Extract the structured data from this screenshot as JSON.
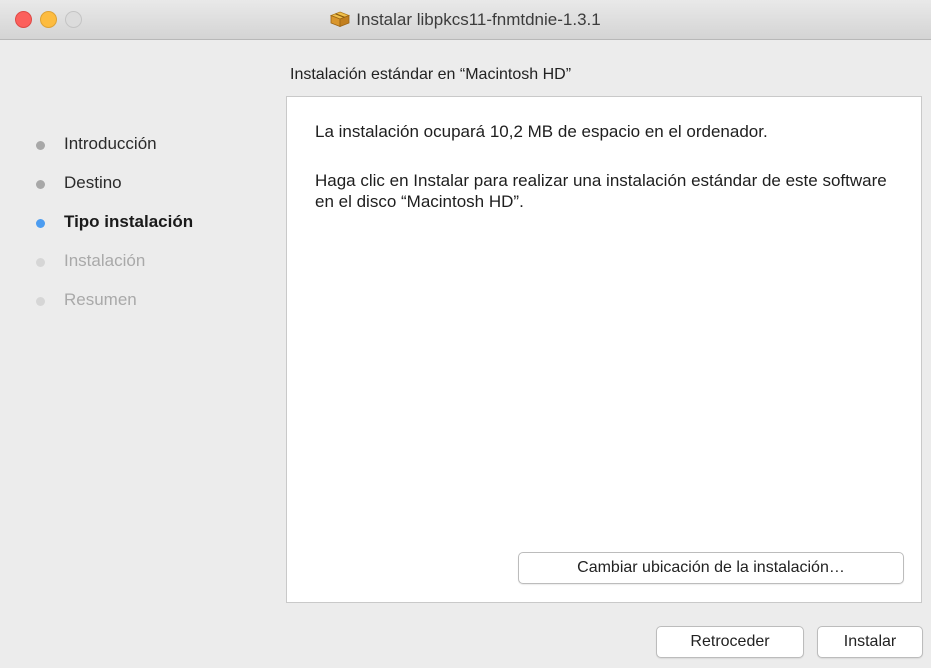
{
  "window": {
    "title": "Instalar libpkcs11-fnmtdnie-1.3.1",
    "title_icon": "package-icon"
  },
  "sidebar": {
    "steps": [
      {
        "label": "Introducción",
        "state": "done"
      },
      {
        "label": "Destino",
        "state": "done"
      },
      {
        "label": "Tipo instalación",
        "state": "active"
      },
      {
        "label": "Instalación",
        "state": "pending"
      },
      {
        "label": "Resumen",
        "state": "pending"
      }
    ]
  },
  "main": {
    "heading": "Instalación estándar en “Macintosh HD”",
    "paragraph1": "La instalación ocupará 10,2 MB de espacio en el ordenador.",
    "paragraph2": "Haga clic en Instalar para realizar una instalación estándar de este software en el disco “Macintosh HD”.",
    "change_location_label": "Cambiar ubicación de la instalación…"
  },
  "footer": {
    "back_label": "Retroceder",
    "install_label": "Instalar"
  },
  "colors": {
    "accent": "#4c9cf0",
    "close": "#fc605c",
    "minimize": "#fdbc40"
  }
}
